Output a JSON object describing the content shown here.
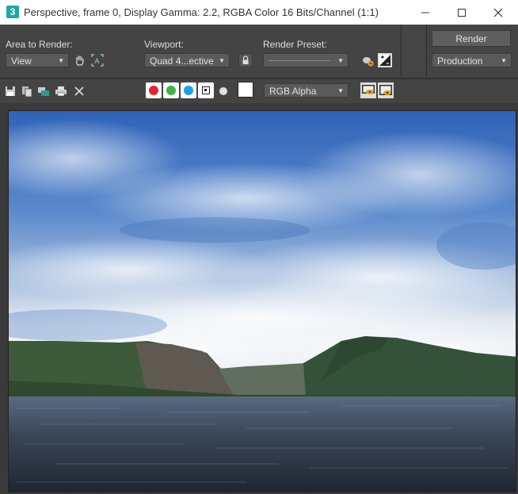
{
  "window": {
    "app_icon": "3",
    "title": "Perspective, frame 0, Display Gamma: 2.2, RGBA Color 16 Bits/Channel (1:1)",
    "controls": [
      "minimize-icon",
      "maximize-icon",
      "close-icon"
    ]
  },
  "toolbar": {
    "area_label": "Area to Render:",
    "area_value": "View",
    "viewport_label": "Viewport:",
    "viewport_value": "Quad 4...ective",
    "preset_label": "Render Preset:",
    "preset_value": "",
    "render_button": "Render",
    "production_value": "Production"
  },
  "toolbar2": {
    "channel_display": "RGB Alpha",
    "icons": [
      "save-icon",
      "copy-icon",
      "clone-icon",
      "print-icon",
      "clear-icon"
    ],
    "channels": [
      {
        "name": "red-channel",
        "color": "#e8232f"
      },
      {
        "name": "green-channel",
        "color": "#3db34a"
      },
      {
        "name": "blue-channel",
        "color": "#1aa3e8"
      }
    ],
    "swatch_color": "#ffffff"
  },
  "colors": {
    "bg_dark": "#3c3c3c",
    "panel": "#444444",
    "dropdown": "#5a5a5a",
    "accent_teal": "#1fa6a6"
  }
}
